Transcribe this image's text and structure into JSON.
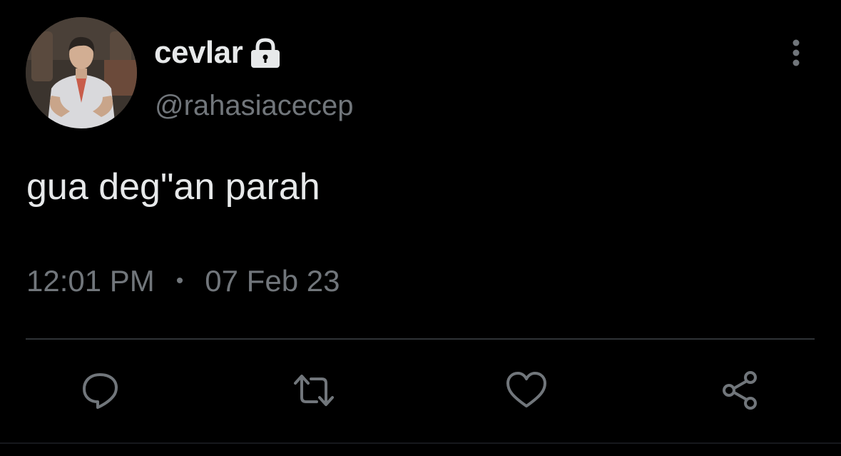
{
  "tweet": {
    "display_name": "cevlar",
    "handle": "@rahasiacecep",
    "text": "gua deg\"an parah",
    "time": "12:01 PM",
    "separator": "•",
    "date": "07 Feb 23",
    "protected": true
  },
  "icons": {
    "avatar": "profile-photo",
    "lock": "lock-icon",
    "more": "more-vertical-icon",
    "reply": "reply-icon",
    "retweet": "retweet-icon",
    "like": "heart-icon",
    "share": "share-icon"
  },
  "colors": {
    "background": "#000000",
    "primary_text": "#e7e9ea",
    "secondary_text": "#71767b",
    "divider": "#2f3336"
  }
}
